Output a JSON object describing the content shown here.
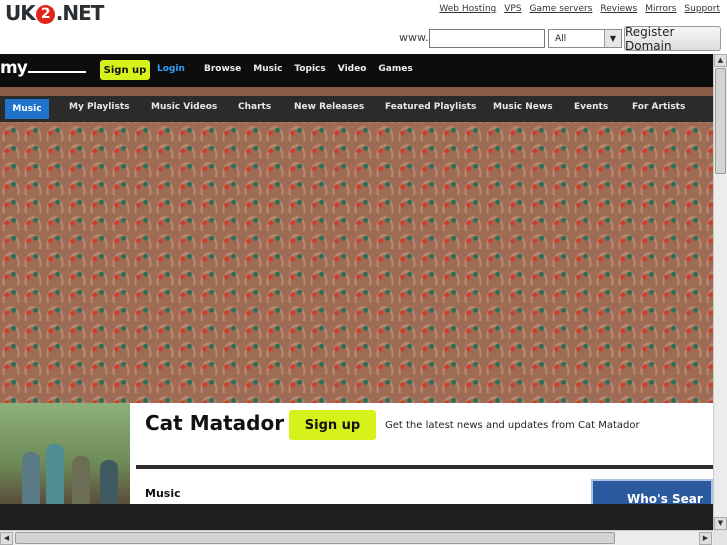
{
  "hosting": {
    "logo_pre": "UK",
    "logo_mid": "2",
    "logo_post": ".NET",
    "links": [
      "Web Hosting",
      "VPS",
      "Game servers",
      "Reviews",
      "Mirrors",
      "Support"
    ],
    "www_label": "www.",
    "domain_value": "",
    "tld_selected": "All",
    "register_label": "Register Domain"
  },
  "myspace": {
    "logo": "my",
    "signup_label": "Sign up",
    "login_label": "Login",
    "nav": [
      "Browse",
      "Music",
      "Topics",
      "Video",
      "Games"
    ]
  },
  "subnav": {
    "active": "Music",
    "items": [
      "My Playlists",
      "Music Videos",
      "Charts",
      "New Releases",
      "Featured Playlists",
      "Music News",
      "Events",
      "For Artists"
    ]
  },
  "profile": {
    "artist_name": "Cat Matador",
    "signup_label": "Sign up",
    "signup_text": "Get the latest news and updates from Cat Matador",
    "section_heading": "Music",
    "promo_text": "Who's Sear"
  },
  "colors": {
    "accent_green": "#d6f21a",
    "active_tab_blue": "#1f73c9",
    "header_black": "#0d0d0d"
  }
}
